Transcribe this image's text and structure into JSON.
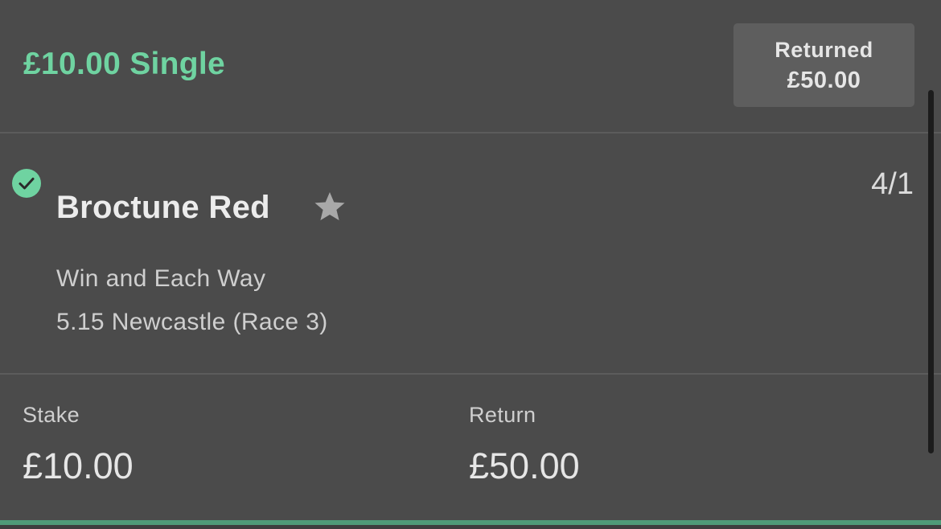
{
  "bet": {
    "title": "£10.00 Single",
    "returned_label": "Returned",
    "returned_amount": "£50.00"
  },
  "selection": {
    "status_icon": "check-circle-icon",
    "name": "Broctune Red",
    "favourite_icon": "star-icon",
    "odds": "4/1",
    "market": "Win and Each Way",
    "race": "5.15 Newcastle (Race 3)"
  },
  "summary": {
    "stake_label": "Stake",
    "stake_value": "£10.00",
    "return_label": "Return",
    "return_value": "£50.00"
  },
  "colors": {
    "accent_green": "#6fd3a1",
    "background": "#4b4b4b",
    "returned_box": "#5e5e5e"
  }
}
